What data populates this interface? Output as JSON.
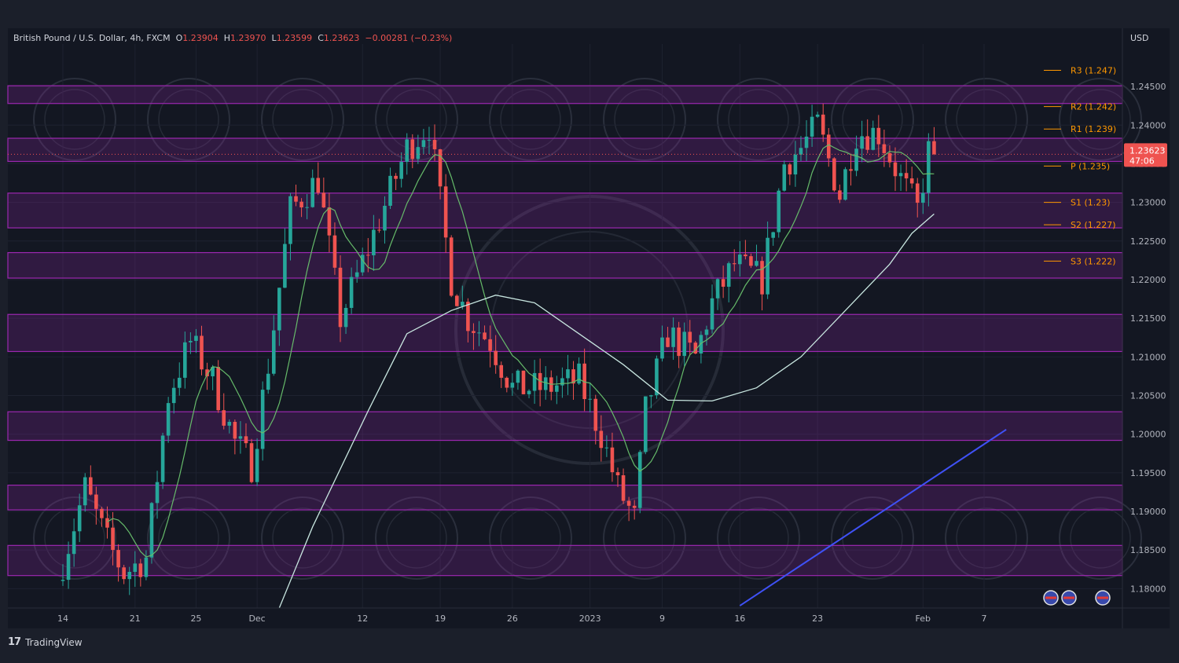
{
  "header": {
    "symbol": "British Pound / U.S. Dollar, 4h, FXCM",
    "open_label": "O",
    "open": "1.23904",
    "high_label": "H",
    "high": "1.23970",
    "low_label": "L",
    "low": "1.23599",
    "close_label": "C",
    "close": "1.23623",
    "change": "−0.00281 (−0.23%)"
  },
  "currency": "USD",
  "brand": "TradingView",
  "price_tag": {
    "price": "1.23623",
    "countdown": "47:06"
  },
  "colors": {
    "up": "#26a69a",
    "down": "#ef5350",
    "zone": "#9c27b0",
    "pivot": "#ff9800",
    "ma_fast": "#66bb6a",
    "ma_slow": "#c8e6e0",
    "trend": "#3f51f5"
  },
  "chart_data": {
    "type": "candlestick",
    "timeframe": "4h",
    "ylim": [
      1.1775,
      1.2505
    ],
    "y_ticks": [
      1.18,
      1.185,
      1.19,
      1.195,
      1.2,
      1.205,
      1.21,
      1.215,
      1.22,
      1.225,
      1.23,
      1.235,
      1.24,
      1.245
    ],
    "y_tick_labels": [
      "1.18000",
      "1.18500",
      "1.19000",
      "1.19500",
      "1.20000",
      "1.20500",
      "1.21000",
      "1.21500",
      "1.22000",
      "1.22500",
      "1.23000",
      "1.23500",
      "1.24000",
      "1.24500"
    ],
    "x_ticks": [
      {
        "label": "14",
        "i": 0
      },
      {
        "label": "21",
        "i": 13
      },
      {
        "label": "25",
        "i": 24
      },
      {
        "label": "Dec",
        "i": 35
      },
      {
        "label": "12",
        "i": 54
      },
      {
        "label": "19",
        "i": 68
      },
      {
        "label": "26",
        "i": 81
      },
      {
        "label": "2023",
        "i": 95
      },
      {
        "label": "9",
        "i": 108
      },
      {
        "label": "16",
        "i": 122
      },
      {
        "label": "23",
        "i": 136
      },
      {
        "label": "Feb",
        "i": 155
      },
      {
        "label": "7",
        "i": 166
      }
    ],
    "n_slots": 170,
    "anchors": [
      [
        0,
        1.181
      ],
      [
        5,
        1.193
      ],
      [
        9,
        1.186
      ],
      [
        12,
        1.182
      ],
      [
        16,
        1.184
      ],
      [
        20,
        1.205
      ],
      [
        24,
        1.212
      ],
      [
        28,
        1.207
      ],
      [
        32,
        1.199
      ],
      [
        35,
        1.196
      ],
      [
        38,
        1.209
      ],
      [
        42,
        1.229
      ],
      [
        47,
        1.233
      ],
      [
        51,
        1.215
      ],
      [
        56,
        1.224
      ],
      [
        63,
        1.237
      ],
      [
        67,
        1.24
      ],
      [
        71,
        1.22
      ],
      [
        74,
        1.215
      ],
      [
        78,
        1.212
      ],
      [
        82,
        1.206
      ],
      [
        88,
        1.206
      ],
      [
        94,
        1.207
      ],
      [
        98,
        1.2
      ],
      [
        101,
        1.193
      ],
      [
        104,
        1.189
      ],
      [
        106,
        1.203
      ],
      [
        110,
        1.213
      ],
      [
        115,
        1.21
      ],
      [
        118,
        1.217
      ],
      [
        122,
        1.222
      ],
      [
        127,
        1.22
      ],
      [
        131,
        1.235
      ],
      [
        134,
        1.237
      ],
      [
        137,
        1.24
      ],
      [
        141,
        1.231
      ],
      [
        144,
        1.239
      ],
      [
        148,
        1.239
      ],
      [
        152,
        1.233
      ],
      [
        155,
        1.229
      ],
      [
        157,
        1.2365
      ]
    ],
    "candles_drawn": 158,
    "ma_fast_period": 9,
    "ma_slow": [
      [
        39,
        1.1775
      ],
      [
        45,
        1.188
      ],
      [
        55,
        1.203
      ],
      [
        62,
        1.213
      ],
      [
        70,
        1.216
      ],
      [
        78,
        1.218
      ],
      [
        85,
        1.217
      ],
      [
        93,
        1.213
      ],
      [
        101,
        1.209
      ],
      [
        109,
        1.2044
      ],
      [
        117,
        1.2043
      ],
      [
        125,
        1.206
      ],
      [
        133,
        1.21
      ],
      [
        141,
        1.216
      ],
      [
        149,
        1.222
      ],
      [
        153,
        1.226
      ],
      [
        157,
        1.2285
      ]
    ],
    "zones": [
      [
        1.2428,
        1.2451
      ],
      [
        1.2353,
        1.2383
      ],
      [
        1.2267,
        1.2312
      ],
      [
        1.2202,
        1.2235
      ],
      [
        1.2107,
        1.2155
      ],
      [
        1.1992,
        1.2029
      ],
      [
        1.1902,
        1.1934
      ],
      [
        1.1817,
        1.1856
      ]
    ],
    "pivots": [
      {
        "label": "R3 (1.247)",
        "value": 1.2471
      },
      {
        "label": "R2 (1.242)",
        "value": 1.2424
      },
      {
        "label": "R1 (1.239)",
        "value": 1.2395
      },
      {
        "label": "P (1.235)",
        "value": 1.2347
      },
      {
        "label": "S1 (1.23)",
        "value": 1.23
      },
      {
        "label": "S2 (1.227)",
        "value": 1.2271
      },
      {
        "label": "S3 (1.222)",
        "value": 1.2224
      }
    ],
    "trendline": [
      [
        122,
        1.1778
      ],
      [
        170,
        1.2006
      ]
    ],
    "current_price": 1.23623
  }
}
